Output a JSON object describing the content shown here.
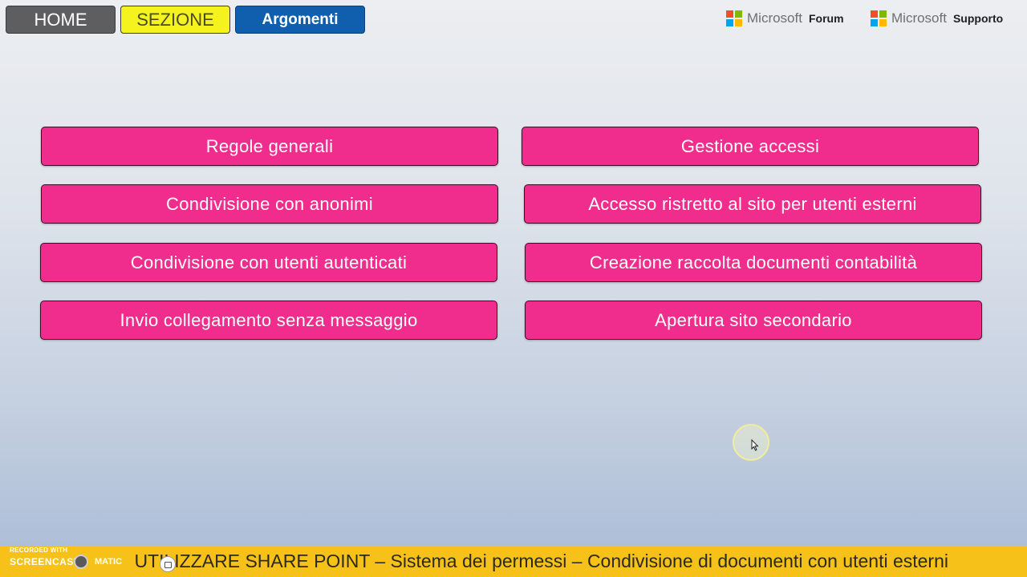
{
  "nav": {
    "home": "HOME",
    "sezione": "SEZIONE",
    "argomenti": "Argomenti"
  },
  "microsoft_links": [
    {
      "brand": "Microsoft",
      "label": "Forum"
    },
    {
      "brand": "Microsoft",
      "label": "Supporto"
    }
  ],
  "ms_logo_colors": [
    "#f25022",
    "#7fba00",
    "#00a4ef",
    "#ffb900"
  ],
  "topics": [
    "Regole generali",
    "Gestione accessi",
    "Condivisione con anonimi",
    "Accesso ristretto al sito per utenti esterni",
    "Condivisione con utenti autenticati",
    "Creazione raccolta documenti contabilità",
    "Invio collegamento senza messaggio",
    "Apertura sito secondario"
  ],
  "footer": {
    "title": "UTILIZZARE SHARE POINT – Sistema dei permessi – Condivisione di documenti con utenti esterni"
  },
  "watermark": {
    "line1": "RECORDED WITH",
    "line2": "SCREENCAST",
    "line3": "MATIC"
  },
  "colors": {
    "topic_button": "#f02d8d",
    "home_button": "#5e5e60",
    "sezione_button": "#f5f31e",
    "argomenti_button": "#0f5fae",
    "footer_bar": "#f6c21a"
  }
}
